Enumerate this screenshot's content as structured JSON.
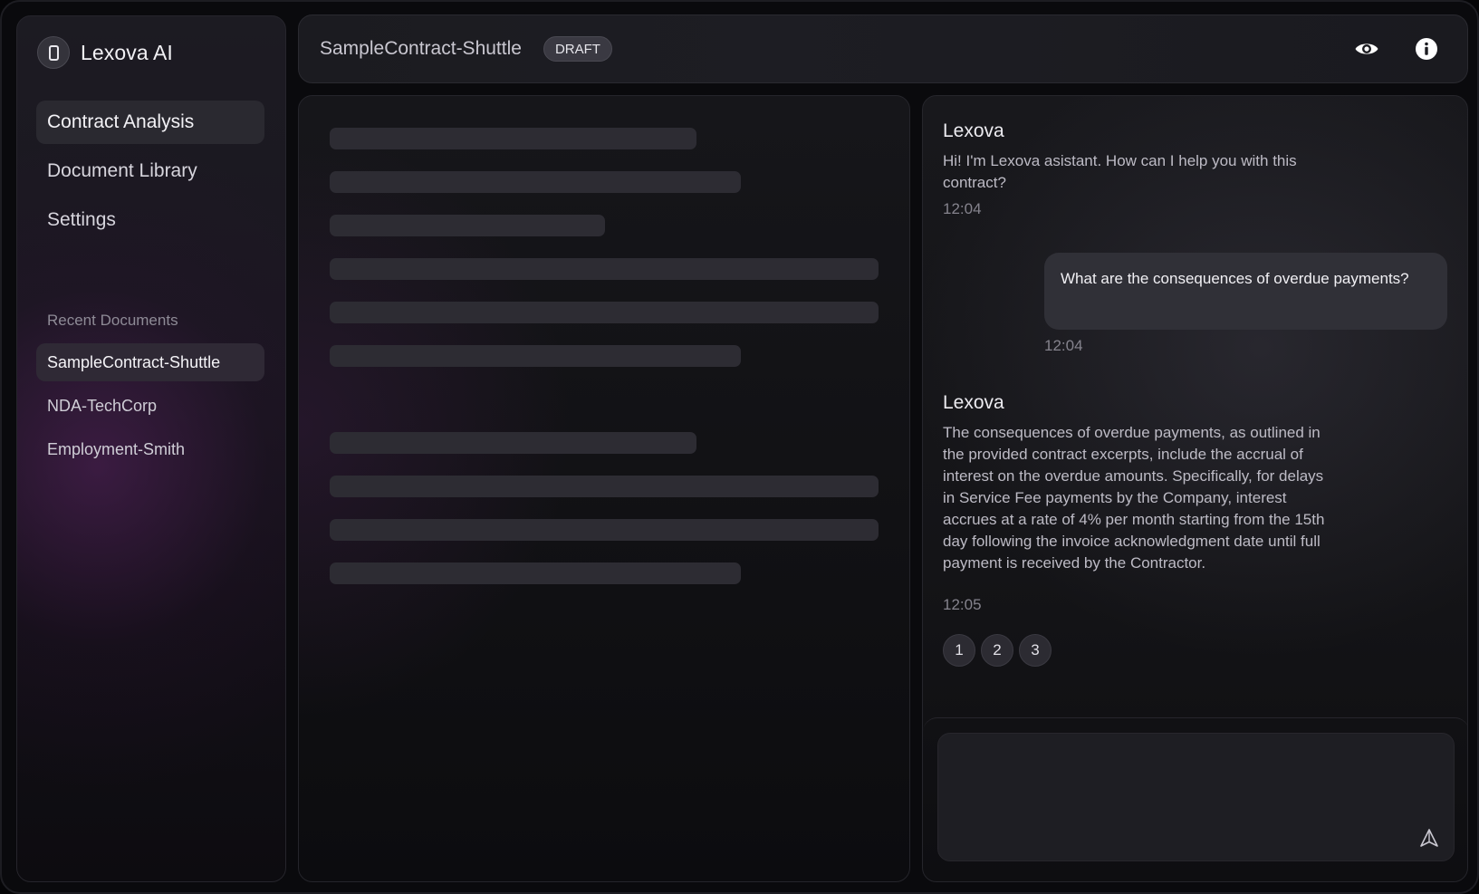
{
  "brand": {
    "name": "Lexova AI",
    "icon": "document-icon"
  },
  "nav": {
    "items": [
      {
        "label": "Contract Analysis",
        "active": true
      },
      {
        "label": "Document Library",
        "active": false
      },
      {
        "label": "Settings",
        "active": false
      }
    ]
  },
  "recent": {
    "label": "Recent Documents",
    "items": [
      {
        "label": "SampleContract-Shuttle",
        "active": true
      },
      {
        "label": "NDA-TechCorp",
        "active": false
      },
      {
        "label": "Employment-Smith",
        "active": false
      }
    ]
  },
  "topbar": {
    "doc_title": "SampleContract-Shuttle",
    "status_badge": "DRAFT",
    "icons": [
      "eye-icon",
      "info-icon"
    ]
  },
  "document": {
    "state": "loading"
  },
  "chat": {
    "messages": [
      {
        "sender": "Lexova",
        "text": "Hi! I'm Lexova asistant. How can I help you with this contract?",
        "time": "12:04"
      },
      {
        "sender": "user",
        "text": "What are the consequences of overdue payments?",
        "time": "12:04"
      },
      {
        "sender": "Lexova",
        "text": "The consequences of overdue payments, as outlined in the provided contract excerpts, include the accrual of interest on the overdue amounts. Specifically, for delays in Service Fee payments by the Company, interest accrues at a rate of 4% per month starting from the 15th day following the invoice acknowledgment date until full payment is received by the Contractor.",
        "time": "12:05"
      }
    ],
    "references": [
      "1",
      "2",
      "3"
    ],
    "composer": {
      "value": "",
      "placeholder": "",
      "send_icon": "send-icon"
    }
  },
  "colors": {
    "background": "#0a0a0d",
    "panel": "#16161a",
    "skeleton": "#2d2c33",
    "accent_glow": "#582260",
    "text_primary": "#f1f0f4",
    "text_muted": "#85838d"
  }
}
